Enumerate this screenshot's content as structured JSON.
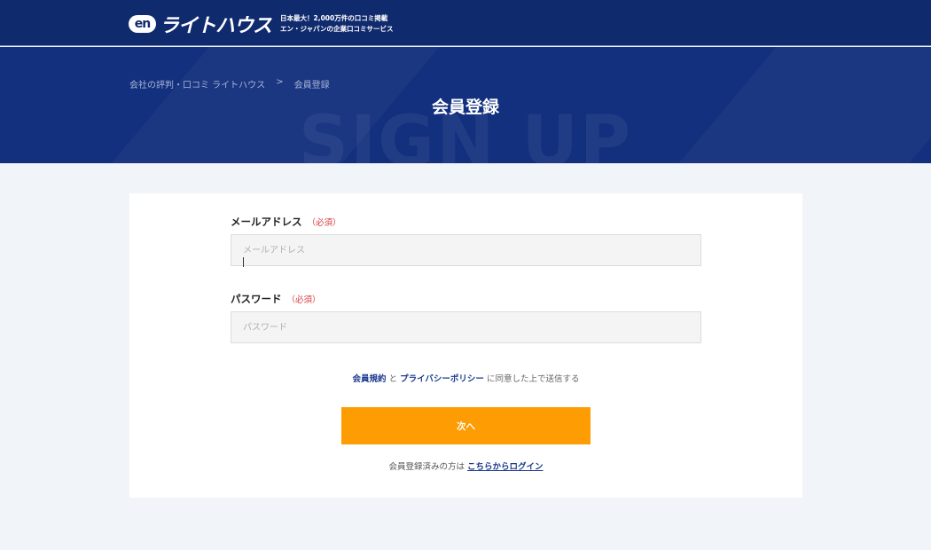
{
  "header": {
    "logo_badge": "en",
    "logo_name": "ライトハウス",
    "tagline_line1": "日本最大！2,000万件の口コミ掲載",
    "tagline_line2": "エン・ジャパンの企業口コミサービス"
  },
  "hero": {
    "breadcrumb": [
      "会社の評判・口コミ ライトハウス",
      ">",
      "会員登録"
    ],
    "title": "会員登録",
    "bg_word": "SIGN UP"
  },
  "form": {
    "email": {
      "label": "メールアドレス",
      "required": "（必須）",
      "placeholder": "メールアドレス",
      "value": ""
    },
    "password": {
      "label": "パスワード",
      "required": "（必須）",
      "placeholder": "パスワード",
      "value": ""
    },
    "agreement": {
      "terms_link": "会員規約",
      "and": "と",
      "privacy_link": "プライバシーポリシー",
      "suffix": "に同意した上で送信する"
    },
    "submit_label": "次へ",
    "login_prompt": "会員登録済みの方は",
    "login_link": "こちらからログイン"
  },
  "colors": {
    "header_bg": "#102a6e",
    "hero_bg": "#13307e",
    "accent_orange": "#fd9d03",
    "required_red": "#d9393e",
    "link_blue": "#1b3a8f"
  }
}
